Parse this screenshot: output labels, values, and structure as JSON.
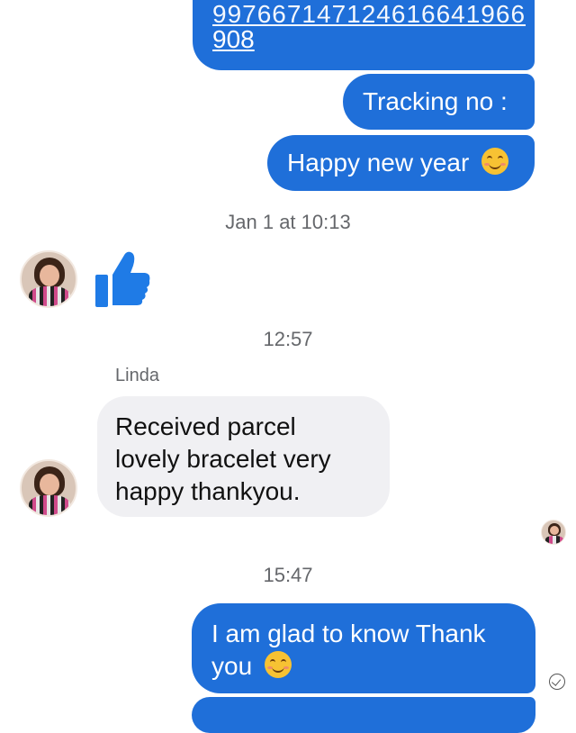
{
  "messages": {
    "out_cut_line": "997667147124616641966",
    "out_tracking_number_tail": "908",
    "out_tracking_label": "Tracking no :",
    "out_new_year": "Happy new year",
    "out_glad_line1": "I am glad to know Thank",
    "out_glad_line2": "you"
  },
  "timestamps": {
    "t1": "Jan 1 at 10:13",
    "t2": "12:57",
    "t3": "15:47"
  },
  "incoming": {
    "sender": "Linda",
    "line1": "Received parcel",
    "line2": "lovely bracelet very",
    "line3": "happy thankyou."
  },
  "colors": {
    "outgoing_bubble": "#1f6fd9",
    "incoming_bubble": "#f0f0f3",
    "timestamp_text": "#65676b"
  },
  "icons": [
    "thumbs-up-icon",
    "smiling-emoji-icon",
    "relieved-emoji-icon",
    "seen-check-icon"
  ]
}
